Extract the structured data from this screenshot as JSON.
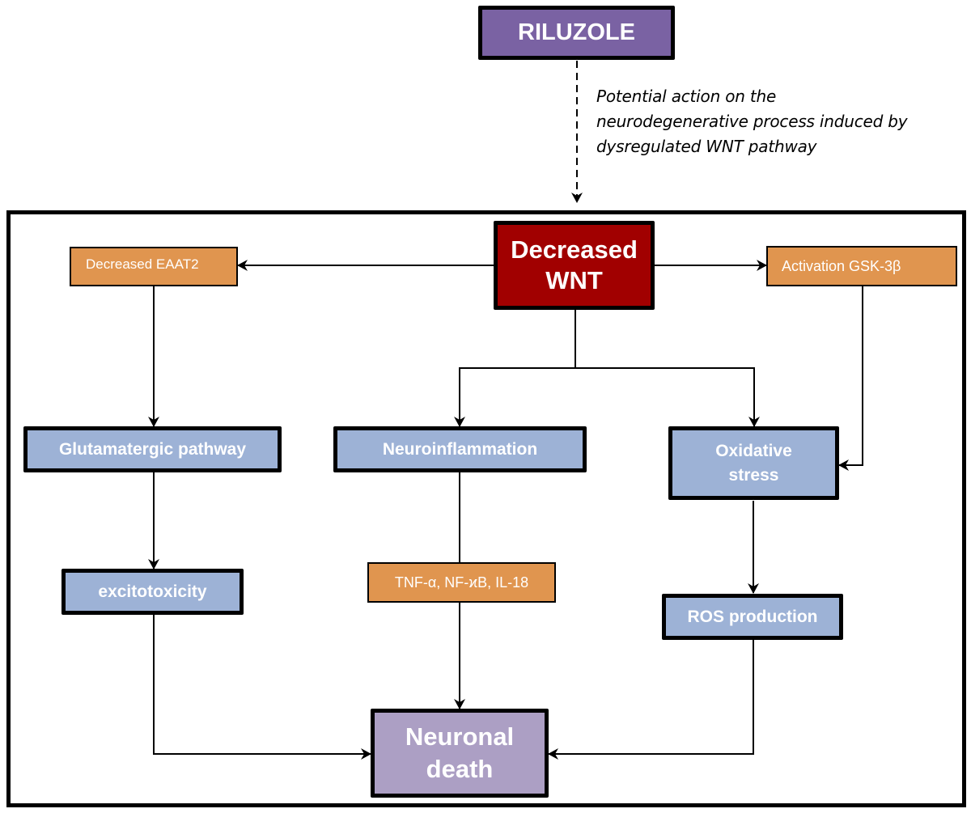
{
  "diagram": {
    "top_node": "RILUZOLE",
    "annotation": {
      "lines": [
        "Potential action on the",
        "neurodegenerative process induced by",
        "dysregulated WNT pathway"
      ]
    },
    "nodes": {
      "decreased_wnt": {
        "line1": "Decreased",
        "line2": "WNT"
      },
      "decreased_eaat2": "Decreased EAAT2",
      "activation_gsk3b": "Activation GSK-3β",
      "glutamatergic": "Glutamatergic pathway",
      "neuroinflammation": "Neuroinflammation",
      "oxidative_stress": {
        "line1": "Oxidative",
        "line2": "stress"
      },
      "excitotoxicity": "excitotoxicity",
      "cytokines": "TNF-α, NF-ϰB, IL-18",
      "ros_production": "ROS production",
      "neuronal_death": {
        "line1": "Neuronal",
        "line2": "death"
      }
    },
    "edges": [
      {
        "from": "RILUZOLE",
        "to": "Decreased WNT",
        "style": "dashed"
      },
      {
        "from": "Decreased WNT",
        "to": "Decreased EAAT2",
        "style": "solid"
      },
      {
        "from": "Decreased WNT",
        "to": "Activation GSK-3β",
        "style": "solid"
      },
      {
        "from": "Decreased WNT",
        "to": "Neuroinflammation",
        "style": "solid"
      },
      {
        "from": "Decreased WNT",
        "to": "Oxidative stress",
        "style": "solid"
      },
      {
        "from": "Decreased EAAT2",
        "to": "Glutamatergic pathway",
        "style": "solid"
      },
      {
        "from": "Activation GSK-3β",
        "to": "Oxidative stress",
        "style": "solid"
      },
      {
        "from": "Glutamatergic pathway",
        "to": "excitotoxicity",
        "style": "solid"
      },
      {
        "from": "Neuroinflammation",
        "to": "TNF-α, NF-ϰB, IL-18",
        "style": "line"
      },
      {
        "from": "Oxidative stress",
        "to": "ROS production",
        "style": "solid"
      },
      {
        "from": "excitotoxicity",
        "to": "Neuronal death",
        "style": "solid"
      },
      {
        "from": "TNF-α, NF-ϰB, IL-18",
        "to": "Neuronal death",
        "style": "solid"
      },
      {
        "from": "ROS production",
        "to": "Neuronal death",
        "style": "solid"
      }
    ],
    "colors": {
      "riluzole": "#7a62a3",
      "wnt": "#a10000",
      "mediator": "#e0954f",
      "process": "#9db2d6",
      "outcome": "#ac9fc4"
    }
  }
}
